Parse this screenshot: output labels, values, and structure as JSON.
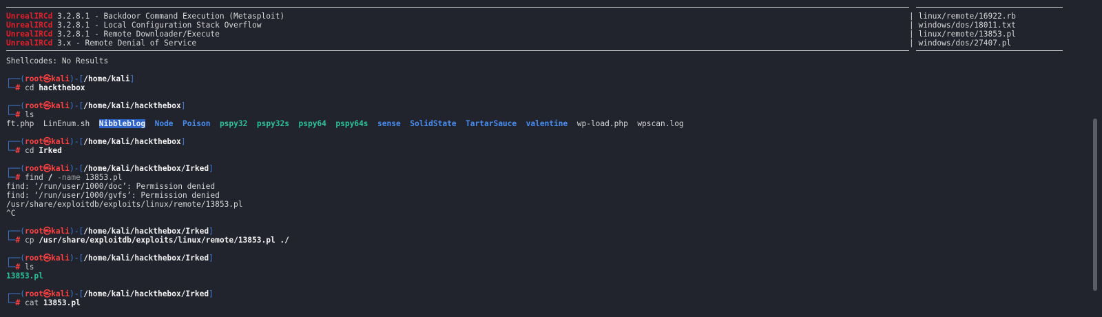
{
  "search_results": [
    {
      "name": "UnrealIRCd",
      "desc": " 3.2.8.1 - Backdoor Command Execution (Metasploit)",
      "path": "| linux/remote/16922.rb"
    },
    {
      "name": "UnrealIRCd",
      "desc": " 3.2.8.1 - Local Configuration Stack Overflow",
      "path": "| windows/dos/18011.txt"
    },
    {
      "name": "UnrealIRCd",
      "desc": " 3.2.8.1 - Remote Downloader/Execute",
      "path": "| linux/remote/13853.pl"
    },
    {
      "name": "UnrealIRCd",
      "desc": " 3.x - Remote Denial of Service",
      "path": "| windows/dos/27407.pl"
    }
  ],
  "shellcodes_line": "Shellcodes: No Results",
  "prompt": {
    "top_prefix": "┌──(",
    "user": "root㉿kali",
    "mid": ")-[",
    "close": "]",
    "bottom_prefix": "└─",
    "hash": "# "
  },
  "blocks": [
    {
      "cwd": "/home/kali",
      "cmd": "cd",
      "arg": " hackthebox"
    },
    {
      "cwd": "/home/kali/hackthebox",
      "cmd": "ls",
      "arg": ""
    },
    {
      "cwd": "/home/kali/hackthebox",
      "cmd": "cd",
      "arg": " Irked"
    },
    {
      "cwd": "/home/kali/hackthebox/Irked",
      "cmd": "find",
      "arg": " / ",
      "opt": "-name",
      "arg2": " 13853.pl"
    },
    {
      "cwd": "/home/kali/hackthebox/Irked",
      "cmd": "cp",
      "arg": " /usr/share/exploitdb/exploits/linux/remote/13853.pl ./"
    },
    {
      "cwd": "/home/kali/hackthebox/Irked",
      "cmd": "ls",
      "arg": ""
    },
    {
      "cwd": "/home/kali/hackthebox/Irked",
      "cmd": "cat",
      "arg": " 13853.pl"
    }
  ],
  "ls_output": [
    {
      "name": "ft.php",
      "kind": "file"
    },
    {
      "name": "LinEnum.sh",
      "kind": "file"
    },
    {
      "name": "Nibbleblog",
      "kind": "selected"
    },
    {
      "name": "Node",
      "kind": "dir"
    },
    {
      "name": "Poison",
      "kind": "dir"
    },
    {
      "name": "pspy32",
      "kind": "exe"
    },
    {
      "name": "pspy32s",
      "kind": "exe"
    },
    {
      "name": "pspy64",
      "kind": "exe"
    },
    {
      "name": "pspy64s",
      "kind": "exe"
    },
    {
      "name": "sense",
      "kind": "dir"
    },
    {
      "name": "SolidState",
      "kind": "dir"
    },
    {
      "name": "TartarSauce",
      "kind": "dir"
    },
    {
      "name": "valentine",
      "kind": "dir"
    },
    {
      "name": "wp-load.php",
      "kind": "file"
    },
    {
      "name": "wpscan.log",
      "kind": "file"
    }
  ],
  "find_output": [
    "find: ‘/run/user/1000/doc’: Permission denied",
    "find: ‘/run/user/1000/gvfs’: Permission denied",
    "/usr/share/exploitdb/exploits/linux/remote/13853.pl",
    "^C"
  ],
  "ls2_output": "13853.pl",
  "colors": {
    "background": "#22242d",
    "prompt_red": "#ff4040",
    "prompt_blue": "#3d7cd8",
    "dir_blue": "#4a8df0",
    "exe_green": "#2bc29a",
    "selection": "#2f63c8"
  }
}
